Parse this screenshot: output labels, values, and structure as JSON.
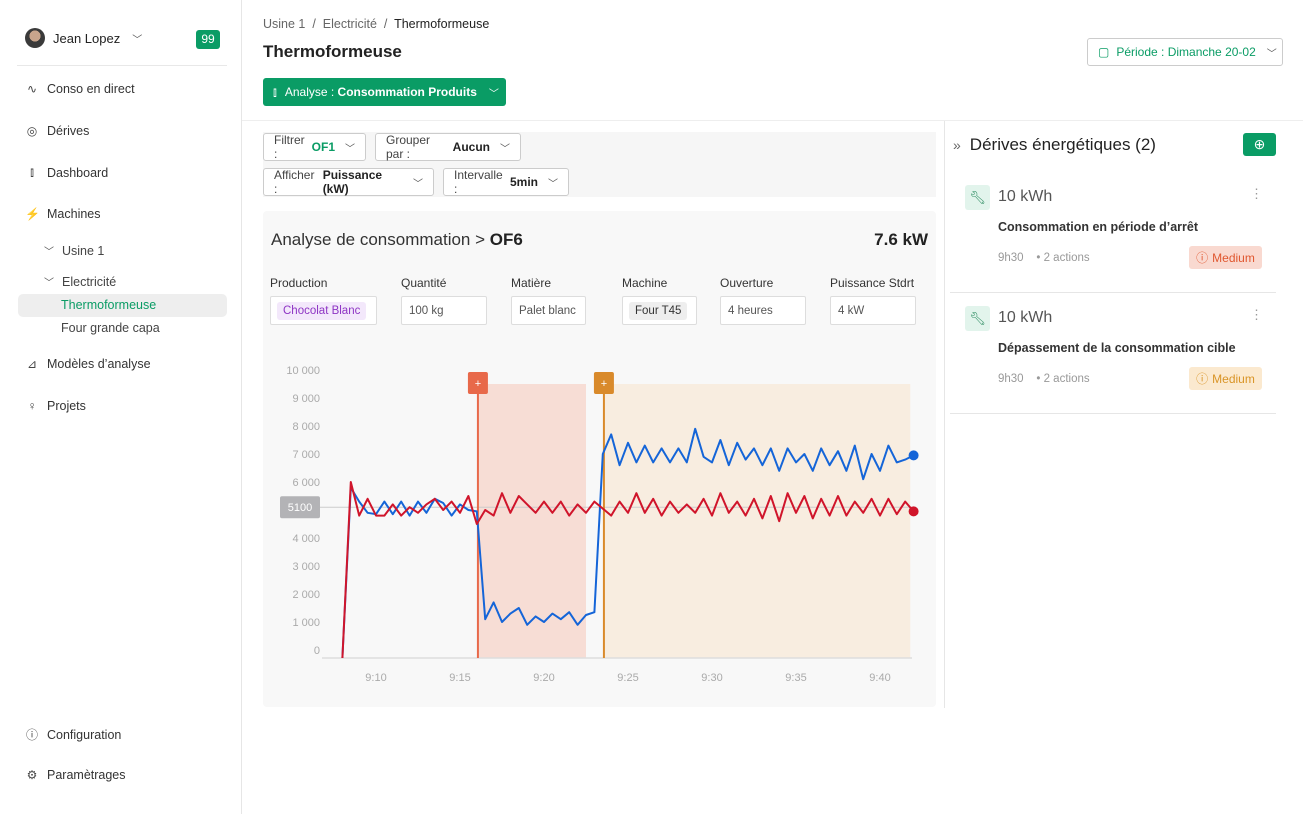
{
  "user": {
    "name": "Jean Lopez",
    "notifications": "99"
  },
  "sidebar": {
    "items": [
      {
        "label": "Conso en direct",
        "icon": "activity-icon"
      },
      {
        "label": "Dérives",
        "icon": "chat-trend-icon"
      },
      {
        "label": "Dashboard",
        "icon": "bar-chart-icon"
      },
      {
        "label": "Machines",
        "icon": "plug-icon"
      },
      {
        "label": "Modèles d’analyse",
        "icon": "chart-model-icon"
      },
      {
        "label": "Projets",
        "icon": "lightbulb-icon"
      }
    ],
    "tree": {
      "usine": "Usine 1",
      "electricite": "Electricité",
      "leaves": [
        "Thermoformeuse",
        "Four grande capa"
      ]
    },
    "bottom": [
      {
        "label": "Configuration",
        "icon": "help-circle-icon"
      },
      {
        "label": "Paramètrages",
        "icon": "gear-icon"
      }
    ]
  },
  "breadcrumb": [
    "Usine 1",
    "Electricité",
    "Thermoformeuse"
  ],
  "page_title": "Thermoformeuse",
  "analyse": {
    "prefix": "Analyse :",
    "value": "Consommation Produits"
  },
  "periode": "Période : Dimanche 20-02",
  "filters": [
    {
      "prefix": "Filtrer :",
      "value": "OF1"
    },
    {
      "prefix": "Grouper par :",
      "value": "Aucun"
    },
    {
      "prefix": "Afficher :",
      "value": "Puissance (kW)"
    },
    {
      "prefix": "Intervalle :",
      "value": "5min"
    }
  ],
  "card": {
    "title_prefix": "Analyse de consommation >",
    "title_of": "OF6",
    "value": "7.6 kW",
    "fields": [
      {
        "label": "Production",
        "value": "Chocolat Blanc"
      },
      {
        "label": "Quantité",
        "value": "100 kg"
      },
      {
        "label": "Matière",
        "value": "Palet blanc"
      },
      {
        "label": "Machine",
        "value": "Four T45"
      },
      {
        "label": "Ouverture",
        "value": "4 heures"
      },
      {
        "label": "Puissance Stdrt",
        "value": "4 kW"
      }
    ]
  },
  "chart_data": {
    "type": "line",
    "ylim": [
      0,
      10000
    ],
    "yticks": [
      "0",
      "1 000",
      "2 000",
      "3 000",
      "4 000",
      "5 000",
      "6 000",
      "7 000",
      "8 000",
      "9 000",
      "10 000"
    ],
    "xticks": [
      "9:10",
      "9:15",
      "9:20",
      "9:25",
      "9:30",
      "9:35",
      "9:40"
    ],
    "reference_line": {
      "value": 5100,
      "label": "5100"
    },
    "x": [
      "9:08:00",
      "9:08:30",
      "9:09:00",
      "9:09:30",
      "9:10:00",
      "9:10:30",
      "9:11:00",
      "9:11:30",
      "9:12:00",
      "9:12:30",
      "9:13:00",
      "9:13:30",
      "9:14:00",
      "9:14:30",
      "9:15:00",
      "9:15:30",
      "9:16:00",
      "9:16:30",
      "9:17:00",
      "9:17:30",
      "9:18:00",
      "9:18:30",
      "9:19:00",
      "9:19:30",
      "9:20:00",
      "9:20:30",
      "9:21:00",
      "9:21:30",
      "9:22:00",
      "9:22:30",
      "9:23:00",
      "9:23:30",
      "9:24:00",
      "9:24:30",
      "9:25:00",
      "9:25:30",
      "9:26:00",
      "9:26:30",
      "9:27:00",
      "9:27:30",
      "9:28:00",
      "9:28:30",
      "9:29:00",
      "9:29:30",
      "9:30:00",
      "9:30:30",
      "9:31:00",
      "9:31:30",
      "9:32:00",
      "9:32:30",
      "9:33:00",
      "9:33:30",
      "9:34:00",
      "9:34:30",
      "9:35:00",
      "9:35:30",
      "9:36:00",
      "9:36:30",
      "9:37:00",
      "9:37:30",
      "9:38:00",
      "9:38:30",
      "9:39:00",
      "9:39:30",
      "9:40:00",
      "9:40:30",
      "9:41:00",
      "9:41:30",
      "9:42:00"
    ],
    "series": [
      {
        "color": "#1565d8",
        "values": [
          0,
          5800,
          5300,
          4900,
          4850,
          5300,
          4850,
          5300,
          4800,
          5300,
          4900,
          5400,
          5250,
          4800,
          5200,
          5000,
          4950,
          1100,
          1700,
          1000,
          1300,
          1500,
          900,
          1200,
          1000,
          1300,
          1100,
          1350,
          900,
          1250,
          1350,
          7000,
          7700,
          6600,
          7400,
          6700,
          7300,
          6700,
          7200,
          6700,
          7200,
          6700,
          7900,
          6900,
          6700,
          7500,
          6600,
          7400,
          6800,
          7200,
          6600,
          7200,
          6400,
          7200,
          6700,
          7000,
          6400,
          7200,
          6600,
          7100,
          6400,
          7300,
          6100,
          7000,
          6400,
          7300,
          6700,
          6800,
          6950
        ]
      },
      {
        "color": "#d0152b",
        "values": [
          0,
          6000,
          4800,
          5400,
          4800,
          4800,
          5200,
          4800,
          5100,
          4900,
          5200,
          5400,
          5000,
          5300,
          4900,
          5500,
          4500,
          5000,
          4800,
          5600,
          4900,
          5500,
          5200,
          4900,
          5300,
          4900,
          5300,
          4800,
          5200,
          4900,
          5300,
          5050,
          4800,
          5300,
          4900,
          5600,
          4900,
          5400,
          4800,
          5300,
          4900,
          5200,
          4900,
          5400,
          4800,
          5600,
          4900,
          5300,
          4800,
          5400,
          4700,
          5500,
          4600,
          5600,
          4900,
          5500,
          4700,
          5400,
          4800,
          5500,
          4800,
          5300,
          4900,
          5400,
          4800,
          5400,
          4850,
          5300,
          4950
        ]
      }
    ],
    "zones": [
      {
        "start": "9:16:04",
        "end": "9:22:30",
        "color": "#e8694a",
        "fill": "#f7ddd5"
      },
      {
        "start": "9:23:34",
        "end": "9:41:48",
        "color": "#d98a2b",
        "fill": "#f8ede0"
      }
    ]
  },
  "drifts": {
    "title": "Dérives énergétiques (2)",
    "items": [
      {
        "value": "10 kWh",
        "name": "Consommation  en période d’arrêt",
        "time": "9h30",
        "actions": "• 2 actions",
        "severity": "Medium",
        "bg": "#f9d9d0",
        "fg": "#e0572f"
      },
      {
        "value": "10 kWh",
        "name": "Dépassement de la consommation cible",
        "time": "9h30",
        "actions": "• 2 actions",
        "severity": "Medium",
        "bg": "#fbe9cf",
        "fg": "#d99426"
      }
    ]
  }
}
